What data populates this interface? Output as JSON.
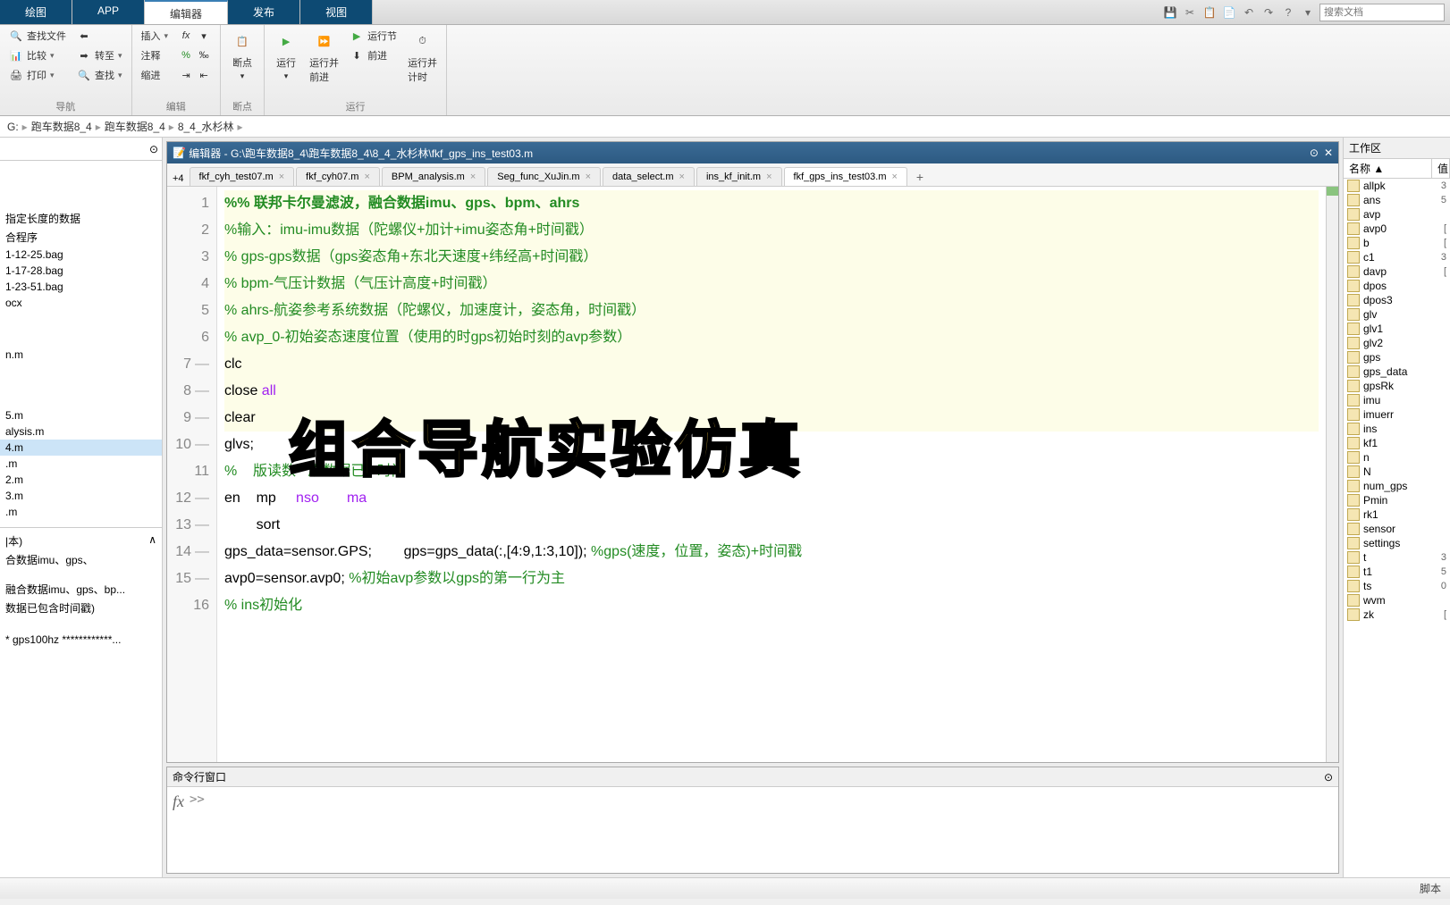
{
  "topTabs": {
    "t1": "绘图",
    "t2": "APP",
    "t3": "编辑器",
    "t4": "发布",
    "t5": "视图"
  },
  "search": {
    "placeholder": "搜索文档"
  },
  "ribbon": {
    "findFiles": "查找文件",
    "compare": "比较",
    "print": "打印",
    "goto": "转至",
    "find": "查找",
    "groupNav": "导航",
    "insert": "插入",
    "comment": "注释",
    "indent": "缩进",
    "groupEdit": "编辑",
    "breakpoint": "断点",
    "groupBreak": "断点",
    "run": "运行",
    "runAdvance": "运行并\n前进",
    "runSection": "运行节",
    "advance": "前进",
    "runTime": "运行并\n计时",
    "groupRun": "运行"
  },
  "breadcrumb": {
    "b0": "G:",
    "b1": "跑车数据8_4",
    "b2": "跑车数据8_4",
    "b3": "8_4_水杉林"
  },
  "leftFiles": {
    "f0": "指定长度的数据",
    "f1": "合程序",
    "f2": "1-12-25.bag",
    "f3": "1-17-28.bag",
    "f4": "1-23-51.bag",
    "f5": "ocx",
    "f6": "n.m",
    "f7": "5.m",
    "f8": "alysis.m",
    "f9": "4.m",
    "f10": ".m",
    "f11": "2.m",
    "f12": "3.m",
    "f13": ".m",
    "detail1": "|本)",
    "detail2": "合数据imu、gps、",
    "detail3": "融合数据imu、gps、bp...",
    "detail4": "数据已包含时间戳)",
    "detail5": "* gps100hz ************..."
  },
  "editor": {
    "title": "编辑器 - G:\\跑车数据8_4\\跑车数据8_4\\8_4_水杉林\\fkf_gps_ins_test03.m",
    "tabs": {
      "more": "+4",
      "t1": "fkf_cyh_test07.m",
      "t2": "fkf_cyh07.m",
      "t3": "BPM_analysis.m",
      "t4": "Seg_func_XuJin.m",
      "t5": "data_select.m",
      "t6": "ins_kf_init.m",
      "t7": "fkf_gps_ins_test03.m"
    },
    "lines": {
      "l1": "%%  联邦卡尔曼滤波，融合数据imu、gps、bpm、ahrs",
      "l2": "%输入：imu-imu数据（陀螺仪+加计+imu姿态角+时间戳）",
      "l3": "%      gps-gps数据（gps姿态角+东北天速度+纬经高+时间戳）",
      "l4": "%      bpm-气压计数据（气压计高度+时间戳）",
      "l5": "%      ahrs-航姿参考系统数据（陀螺仪，加速度计，姿态角，时间戳）",
      "l6": "%      avp_0-初始姿态速度位置（使用的时gps初始时刻的avp参数）",
      "l7": "clc",
      "l8a": "close ",
      "l8b": "all",
      "l9": "clear",
      "l10": "glvs;",
      "l11a": "%",
      "l11b": "版读数",
      "l11c": "原数据已",
      "l11d": "时间",
      "l12a": "en",
      "l12b": "mp",
      "l12c": "nso",
      "l12d": "ma",
      "l13": "sort",
      "l14a": "gps_data=sensor.GPS;",
      "l14b": "gps=gps_data(:,[4:9,1:3,10]); ",
      "l14c": "%gps(速度，位置，姿态)+时间戳",
      "l15a": "avp0=sensor.avp0;   ",
      "l15b": "%初始avp参数以gps的第一行为主",
      "l16": "% ins初始化"
    }
  },
  "overlay": "组合导航实验仿真",
  "cmdWindow": {
    "title": "命令行窗口",
    "prompt": ">>"
  },
  "workspace": {
    "title": "工作区",
    "colName": "名称 ▲",
    "colVal": "值",
    "vars": [
      {
        "n": "allpk",
        "v": "3"
      },
      {
        "n": "ans",
        "v": "5"
      },
      {
        "n": "avp",
        "v": ""
      },
      {
        "n": "avp0",
        "v": "["
      },
      {
        "n": "b",
        "v": "["
      },
      {
        "n": "c1",
        "v": "3"
      },
      {
        "n": "davp",
        "v": "["
      },
      {
        "n": "dpos",
        "v": ""
      },
      {
        "n": "dpos3",
        "v": ""
      },
      {
        "n": "glv",
        "v": ""
      },
      {
        "n": "glv1",
        "v": ""
      },
      {
        "n": "glv2",
        "v": ""
      },
      {
        "n": "gps",
        "v": ""
      },
      {
        "n": "gps_data",
        "v": ""
      },
      {
        "n": "gpsRk",
        "v": ""
      },
      {
        "n": "imu",
        "v": ""
      },
      {
        "n": "imuerr",
        "v": ""
      },
      {
        "n": "ins",
        "v": ""
      },
      {
        "n": "kf1",
        "v": ""
      },
      {
        "n": "n",
        "v": ""
      },
      {
        "n": "N",
        "v": ""
      },
      {
        "n": "num_gps",
        "v": ""
      },
      {
        "n": "Pmin",
        "v": ""
      },
      {
        "n": "rk1",
        "v": ""
      },
      {
        "n": "sensor",
        "v": ""
      },
      {
        "n": "settings",
        "v": ""
      },
      {
        "n": "t",
        "v": "3"
      },
      {
        "n": "t1",
        "v": "5"
      },
      {
        "n": "ts",
        "v": "0"
      },
      {
        "n": "wvm",
        "v": ""
      },
      {
        "n": "zk",
        "v": "["
      }
    ]
  },
  "status": {
    "text": "脚本"
  }
}
